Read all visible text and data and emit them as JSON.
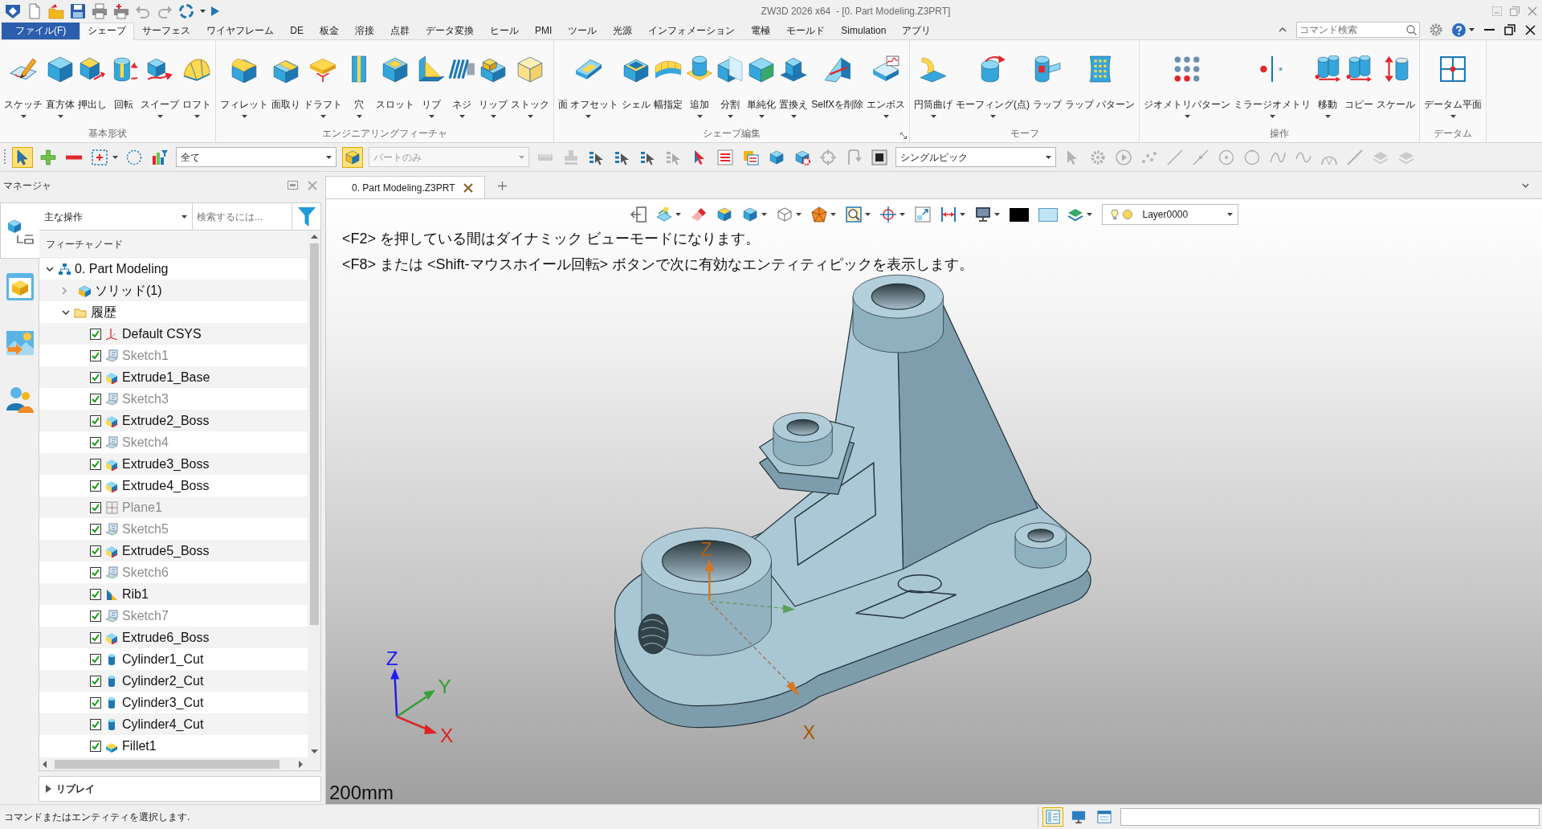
{
  "title_bar": {
    "title": "ZW3D 2026 x64  - [0. Part Modeling.Z3PRT]",
    "quick_access": [
      {
        "disabled": false,
        "dropdown": false
      },
      {
        "disabled": false,
        "dropdown": false
      },
      {
        "disabled": false,
        "dropdown": false
      },
      {
        "disabled": false,
        "dropdown": false
      },
      {
        "disabled": false,
        "dropdown": false
      },
      {
        "disabled": true,
        "dropdown": false
      },
      {
        "disabled": true,
        "dropdown": false
      },
      {
        "disabled": false,
        "dropdown": true
      },
      {
        "disabled": false,
        "dropdown": false
      }
    ]
  },
  "menu": {
    "tabs": [
      {
        "label": "ファイル(F)",
        "kind": "file",
        "selected": false
      },
      {
        "label": "シェープ",
        "kind": "tab",
        "selected": true
      },
      {
        "label": "サーフェス",
        "kind": "tab",
        "selected": false
      },
      {
        "label": "ワイヤフレーム",
        "kind": "tab",
        "selected": false
      },
      {
        "label": "DE",
        "kind": "tab",
        "selected": false
      },
      {
        "label": "板金",
        "kind": "tab",
        "selected": false
      },
      {
        "label": "溶接",
        "kind": "tab",
        "selected": false
      },
      {
        "label": "点群",
        "kind": "tab",
        "selected": false
      },
      {
        "label": "データ変換",
        "kind": "tab",
        "selected": false
      },
      {
        "label": "ヒール",
        "kind": "tab",
        "selected": false
      },
      {
        "label": "PMI",
        "kind": "tab",
        "selected": false
      },
      {
        "label": "ツール",
        "kind": "tab",
        "selected": false
      },
      {
        "label": "光源",
        "kind": "tab",
        "selected": false
      },
      {
        "label": "インフォメーション",
        "kind": "tab",
        "selected": false
      },
      {
        "label": "電極",
        "kind": "tab",
        "selected": false
      },
      {
        "label": "モールド",
        "kind": "tab",
        "selected": false
      },
      {
        "label": "Simulation",
        "kind": "tab",
        "selected": false
      },
      {
        "label": "アプリ",
        "kind": "tab",
        "selected": false
      }
    ],
    "search": {
      "placeholder": "コマンド検索"
    }
  },
  "ribbon": {
    "groups": [
      {
        "label": "基本形状",
        "launcher": false,
        "items": [
          {
            "label": "スケッチ",
            "dropdown": true
          },
          {
            "label": "直方体",
            "dropdown": true
          },
          {
            "label": "押出し",
            "dropdown": false
          },
          {
            "label": "回転",
            "dropdown": false
          },
          {
            "label": "スイープ",
            "dropdown": true
          },
          {
            "label": "ロフト",
            "dropdown": true
          }
        ]
      },
      {
        "label": "エンジニアリングフィーチャ",
        "launcher": false,
        "items": [
          {
            "label": "フィレット",
            "dropdown": true
          },
          {
            "label": "面取り",
            "dropdown": false
          },
          {
            "label": "ドラフト",
            "dropdown": true
          },
          {
            "label": "穴",
            "dropdown": true
          },
          {
            "label": "スロット",
            "dropdown": false
          },
          {
            "label": "リブ",
            "dropdown": true
          },
          {
            "label": "ネジ",
            "dropdown": true
          },
          {
            "label": "リップ",
            "dropdown": true
          },
          {
            "label": "ストック",
            "dropdown": true
          }
        ]
      },
      {
        "label": "シェープ編集",
        "launcher": true,
        "items": [
          {
            "label": "面 オフセット",
            "dropdown": true
          },
          {
            "label": "シェル",
            "dropdown": false
          },
          {
            "label": "幅指定",
            "dropdown": false
          },
          {
            "label": "追加",
            "dropdown": true
          },
          {
            "label": "分割",
            "dropdown": true
          },
          {
            "label": "単純化",
            "dropdown": true
          },
          {
            "label": "置換え",
            "dropdown": true
          },
          {
            "label": "SelfXを削除",
            "dropdown": false
          },
          {
            "label": "エンボス",
            "dropdown": true
          }
        ]
      },
      {
        "label": "モーフ",
        "launcher": false,
        "items": [
          {
            "label": "円筒曲げ",
            "dropdown": true
          },
          {
            "label": "モーフィング(点)",
            "dropdown": true
          },
          {
            "label": "ラップ",
            "dropdown": false
          },
          {
            "label": "ラップ パターン",
            "dropdown": false
          }
        ]
      },
      {
        "label": "操作",
        "launcher": false,
        "items": [
          {
            "label": "ジオメトリパターン",
            "dropdown": true
          },
          {
            "label": "ミラージオメトリ",
            "dropdown": true
          },
          {
            "label": "移動",
            "dropdown": true
          },
          {
            "label": "コピー",
            "dropdown": false
          },
          {
            "label": "スケール",
            "dropdown": false
          }
        ]
      },
      {
        "label": "データム",
        "launcher": false,
        "items": [
          {
            "label": "データム平面",
            "dropdown": true
          }
        ]
      }
    ]
  },
  "toolbar": [
    {
      "kind": "tool",
      "on": true,
      "disabled": false,
      "dropdown": false
    },
    {
      "kind": "tool",
      "on": false,
      "disabled": false,
      "dropdown": false
    },
    {
      "kind": "tool",
      "on": false,
      "disabled": false,
      "dropdown": false
    },
    {
      "kind": "tool",
      "on": false,
      "disabled": false,
      "dropdown": true
    },
    {
      "kind": "tool",
      "on": false,
      "disabled": false,
      "dropdown": false
    },
    {
      "kind": "tool",
      "on": false,
      "disabled": false,
      "dropdown": false
    },
    {
      "kind": "dropdown",
      "value": "全て",
      "disabled": false
    },
    {
      "kind": "tool",
      "on": true,
      "disabled": false,
      "dropdown": false
    },
    {
      "kind": "dropdown",
      "value": "パートのみ",
      "disabled": true
    },
    {
      "kind": "tool",
      "on": false,
      "disabled": true,
      "dropdown": false
    },
    {
      "kind": "tool",
      "on": false,
      "disabled": true,
      "dropdown": false
    },
    {
      "kind": "tool",
      "on": false,
      "disabled": false,
      "dropdown": false
    },
    {
      "kind": "tool",
      "on": false,
      "disabled": false,
      "dropdown": false
    },
    {
      "kind": "tool",
      "on": false,
      "disabled": false,
      "dropdown": false
    },
    {
      "kind": "tool",
      "on": false,
      "disabled": true,
      "dropdown": false
    },
    {
      "kind": "tool",
      "on": false,
      "disabled": false,
      "dropdown": false
    },
    {
      "kind": "tool",
      "on": false,
      "disabled": false,
      "dropdown": false
    },
    {
      "kind": "tool",
      "on": false,
      "disabled": false,
      "dropdown": false
    },
    {
      "kind": "tool",
      "on": false,
      "disabled": false,
      "dropdown": false
    },
    {
      "kind": "tool",
      "on": false,
      "disabled": false,
      "dropdown": false
    },
    {
      "kind": "tool",
      "on": false,
      "disabled": true,
      "dropdown": false
    },
    {
      "kind": "tool",
      "on": false,
      "disabled": true,
      "dropdown": false
    },
    {
      "kind": "tool",
      "on": false,
      "disabled": false,
      "dropdown": false
    },
    {
      "kind": "dropdown",
      "value": "シングルピック",
      "disabled": false
    },
    {
      "kind": "tool",
      "on": false,
      "disabled": true,
      "dropdown": false
    },
    {
      "kind": "tool",
      "on": false,
      "disabled": true,
      "dropdown": false
    },
    {
      "kind": "tool",
      "on": false,
      "disabled": true,
      "dropdown": false
    },
    {
      "kind": "tool",
      "on": false,
      "disabled": true,
      "dropdown": false
    },
    {
      "kind": "tool",
      "on": false,
      "disabled": true,
      "dropdown": false
    },
    {
      "kind": "tool",
      "on": false,
      "disabled": true,
      "dropdown": false
    },
    {
      "kind": "tool",
      "on": false,
      "disabled": true,
      "dropdown": false
    },
    {
      "kind": "tool",
      "on": false,
      "disabled": true,
      "dropdown": false
    },
    {
      "kind": "tool",
      "on": false,
      "disabled": true,
      "dropdown": false
    },
    {
      "kind": "tool",
      "on": false,
      "disabled": true,
      "dropdown": false
    },
    {
      "kind": "tool",
      "on": false,
      "disabled": true,
      "dropdown": false
    },
    {
      "kind": "tool",
      "on": false,
      "disabled": true,
      "dropdown": false
    },
    {
      "kind": "tool",
      "on": false,
      "disabled": true,
      "dropdown": false
    },
    {
      "kind": "tool",
      "on": false,
      "disabled": true,
      "dropdown": false
    }
  ],
  "manager": {
    "title": "マネージャ",
    "side_tabs": [
      {
        "selected": true
      },
      {
        "selected": false
      },
      {
        "selected": false
      },
      {
        "selected": false
      }
    ],
    "filter": {
      "value": "主な操作"
    },
    "search": {
      "placeholder": "検索するには..."
    },
    "tree": {
      "header": "フィーチャノード",
      "items": [
        {
          "label": "0. Part Modeling",
          "kind": "part",
          "expanded": true,
          "children": [
            {
              "label": "ソリッド(1)",
              "kind": "solid",
              "expanded": false
            },
            {
              "label": "履歴",
              "kind": "folder",
              "expanded": true,
              "children": [
                {
                  "label": "Default CSYS",
                  "kind": "csys",
                  "checked": true,
                  "dimmed": false
                },
                {
                  "label": "Sketch1",
                  "kind": "sketch",
                  "checked": true,
                  "dimmed": true
                },
                {
                  "label": "Extrude1_Base",
                  "kind": "extrude",
                  "checked": true,
                  "dimmed": false
                },
                {
                  "label": "Sketch3",
                  "kind": "sketch",
                  "checked": true,
                  "dimmed": true
                },
                {
                  "label": "Extrude2_Boss",
                  "kind": "extrude",
                  "checked": true,
                  "dimmed": false
                },
                {
                  "label": "Sketch4",
                  "kind": "sketch",
                  "checked": true,
                  "dimmed": true
                },
                {
                  "label": "Extrude3_Boss",
                  "kind": "extrude",
                  "checked": true,
                  "dimmed": false
                },
                {
                  "label": "Extrude4_Boss",
                  "kind": "extrude",
                  "checked": true,
                  "dimmed": false
                },
                {
                  "label": "Plane1",
                  "kind": "plane",
                  "checked": true,
                  "dimmed": true
                },
                {
                  "label": "Sketch5",
                  "kind": "sketch",
                  "checked": true,
                  "dimmed": true
                },
                {
                  "label": "Extrude5_Boss",
                  "kind": "extrude",
                  "checked": true,
                  "dimmed": false
                },
                {
                  "label": "Sketch6",
                  "kind": "sketch",
                  "checked": true,
                  "dimmed": true
                },
                {
                  "label": "Rib1",
                  "kind": "rib",
                  "checked": true,
                  "dimmed": false
                },
                {
                  "label": "Sketch7",
                  "kind": "sketch",
                  "checked": true,
                  "dimmed": true
                },
                {
                  "label": "Extrude6_Boss",
                  "kind": "extrude",
                  "checked": true,
                  "dimmed": false
                },
                {
                  "label": "Cylinder1_Cut",
                  "kind": "cylinder",
                  "checked": true,
                  "dimmed": false
                },
                {
                  "label": "Cylinder2_Cut",
                  "kind": "cylinder",
                  "checked": true,
                  "dimmed": false
                },
                {
                  "label": "Cylinder3_Cut",
                  "kind": "cylinder",
                  "checked": true,
                  "dimmed": false
                },
                {
                  "label": "Cylinder4_Cut",
                  "kind": "cylinder",
                  "checked": true,
                  "dimmed": false
                },
                {
                  "label": "Fillet1",
                  "kind": "fillet",
                  "checked": true,
                  "dimmed": false
                }
              ]
            }
          ]
        }
      ]
    },
    "replay": {
      "label": "リプレイ",
      "expanded": false
    }
  },
  "document_tabs": [
    {
      "label": "0. Part Modeling.Z3PRT",
      "selected": true
    }
  ],
  "viewport": {
    "toolbar": [
      {
        "dropdown": false
      },
      {
        "dropdown": true
      },
      {
        "dropdown": false
      },
      {
        "dropdown": false
      },
      {
        "dropdown": true
      },
      {
        "dropdown": true
      },
      {
        "dropdown": true
      },
      {
        "dropdown": true
      },
      {
        "dropdown": true
      },
      {
        "dropdown": false
      },
      {
        "dropdown": true
      },
      {
        "dropdown": true
      },
      {
        "dropdown": false
      },
      {
        "dropdown": false
      },
      {
        "dropdown": true
      }
    ],
    "layer": {
      "value": "Layer0000"
    },
    "messages": [
      "<F2> を押している間はダイナミック ビューモードになります。",
      "<F8> または <Shift-マウスホイール回転> ボタンで次に有効なエンティティピックを表示します。"
    ],
    "origin_axes": [
      "Z",
      "X"
    ],
    "triad_axes": [
      "Z",
      "Y",
      "X"
    ],
    "scale": "200mm"
  },
  "status_bar": {
    "message": "コマンドまたはエンティティを選択します.",
    "buttons": [
      {
        "on": true
      },
      {
        "on": false
      },
      {
        "on": false
      }
    ]
  }
}
